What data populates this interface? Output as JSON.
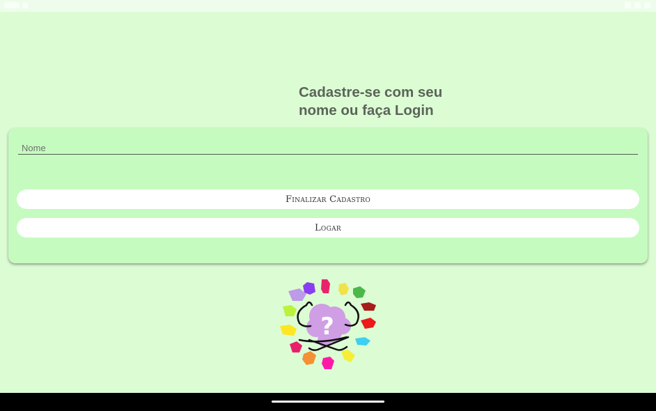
{
  "header": {
    "title": "Cadastre-se com seu nome ou faça Login"
  },
  "form": {
    "name_placeholder": "Nome",
    "name_value": "",
    "finalize_label": "Finalizar Cadastro",
    "login_label": "Logar"
  },
  "colors": {
    "background": "#dcfcd4",
    "card": "#c6fbc0",
    "button": "#ffffff",
    "title_text": "#5b6459",
    "nav_bar": "#000000"
  },
  "icons": {
    "logo": "question-cloud-logo",
    "status_left": [
      "notification-icon"
    ],
    "status_right": [
      "wifi-icon",
      "signal-icon",
      "battery-icon"
    ]
  }
}
